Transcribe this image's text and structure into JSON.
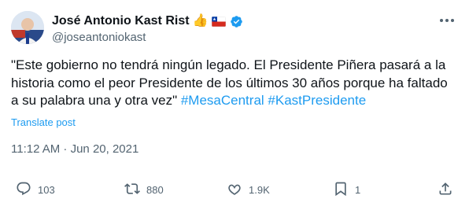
{
  "author": {
    "name": "José Antonio Kast Rist",
    "handle": "@joseantoniokast",
    "badge_emoji": "👍"
  },
  "tweet": {
    "text_plain": "\"Este gobierno no tendrá ningún legado. El Presidente Piñera pasará a la historia como el peor Presidente de los últimos 30 años porque ha faltado a su palabra una y otra vez\"",
    "hashtags": [
      "#MesaCentral",
      "#KastPresidente"
    ],
    "translate_label": "Translate post",
    "timestamp": "11:12 AM · Jun 20, 2021"
  },
  "actions": {
    "replies": "103",
    "reposts": "880",
    "likes": "1.9K",
    "bookmarks": "1"
  },
  "icons": {
    "more": "more-dots-icon",
    "reply": "reply-icon",
    "repost": "repost-icon",
    "like": "heart-icon",
    "bookmark": "bookmark-icon",
    "share": "share-icon",
    "verified": "verified-badge-icon"
  },
  "colors": {
    "accent": "#1d9bf0",
    "secondary_text": "#536471",
    "primary_text": "#0f1419"
  }
}
